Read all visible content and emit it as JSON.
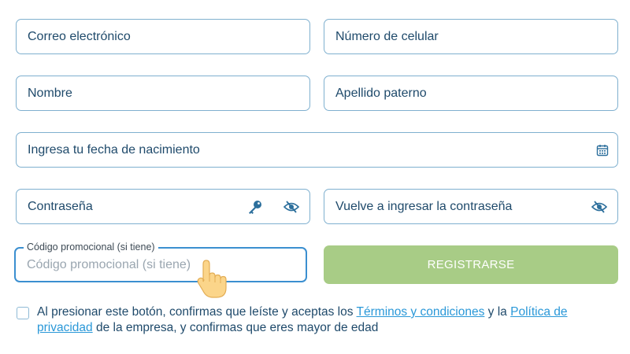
{
  "form": {
    "email": {
      "placeholder": "Correo electrónico"
    },
    "phone": {
      "placeholder": "Número de celular"
    },
    "first_name": {
      "placeholder": "Nombre"
    },
    "last_name": {
      "placeholder": "Apellido paterno"
    },
    "birthdate": {
      "placeholder": "Ingresa tu fecha de nacimiento",
      "icon": "calendar-icon"
    },
    "password": {
      "placeholder": "Contraseña",
      "icons": [
        "key-icon",
        "eye-slash-icon"
      ]
    },
    "password_confirm": {
      "placeholder": "Vuelve a ingresar la contraseña",
      "icon": "eye-slash-icon"
    },
    "promo": {
      "label": "Código promocional (si tiene)",
      "placeholder": "Código promocional (si tiene)"
    },
    "submit_label": "REGISTRARSE"
  },
  "terms": {
    "text_1": "Al presionar este botón, confirmas que leíste y aceptas los",
    "link_terms": "Términos y condiciones",
    "text_2": "y la",
    "link_privacy": "Política de privacidad",
    "text_3": "de la empresa, y confirmas que eres mayor de edad",
    "checked": false
  },
  "colors": {
    "border": "#7fb0cf",
    "active_border": "#3b8fd0",
    "text": "#1f4a6b",
    "button_bg": "#a8cc86",
    "link": "#2a98d8"
  }
}
